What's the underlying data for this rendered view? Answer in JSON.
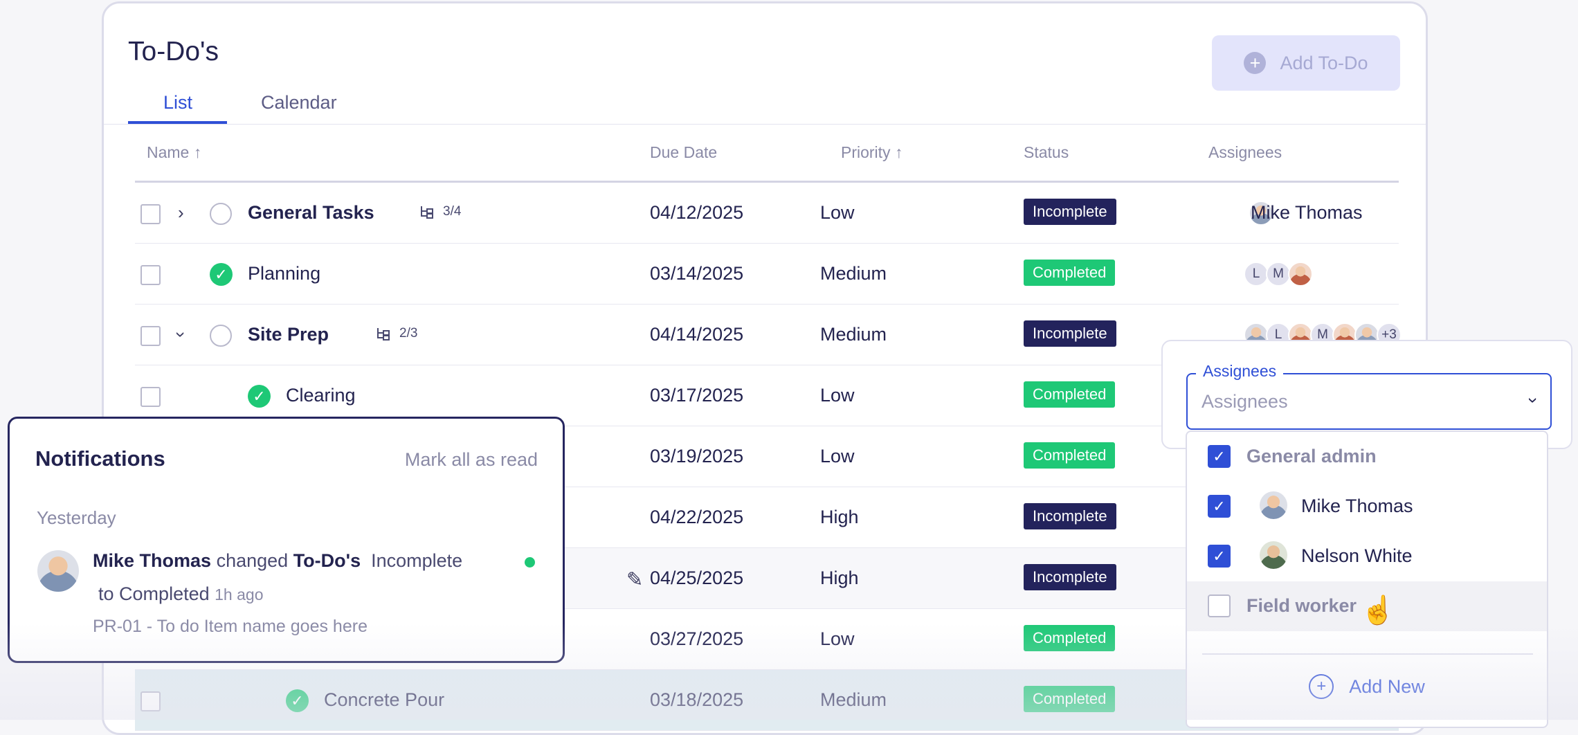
{
  "page": {
    "title": "To-Do's",
    "add_label": "Add To-Do"
  },
  "tabs": {
    "list": "List",
    "calendar": "Calendar"
  },
  "columns": {
    "name": "Name",
    "due": "Due Date",
    "priority": "Priority",
    "status": "Status",
    "assignees": "Assignees"
  },
  "rows": [
    {
      "name": "General Tasks",
      "count": "3/4",
      "due": "04/12/2025",
      "priority": "Low",
      "status": "Incomplete",
      "assignee": "Mike Thomas"
    },
    {
      "name": "Planning",
      "due": "03/14/2025",
      "priority": "Medium",
      "status": "Completed"
    },
    {
      "name": "Site Prep",
      "count": "2/3",
      "due": "04/14/2025",
      "priority": "Medium",
      "status": "Incomplete",
      "more": "+3"
    },
    {
      "name": "Clearing",
      "due": "03/17/2025",
      "priority": "Low",
      "status": "Completed"
    },
    {
      "due": "03/19/2025",
      "priority": "Low",
      "status": "Completed"
    },
    {
      "due": "04/22/2025",
      "priority": "High",
      "status": "Incomplete"
    },
    {
      "due": "04/25/2025",
      "priority": "High",
      "status": "Incomplete"
    },
    {
      "due": "03/27/2025",
      "priority": "Low",
      "status": "Completed"
    },
    {
      "name": "Concrete Pour",
      "due": "03/18/2025",
      "priority": "Medium",
      "status": "Completed"
    }
  ],
  "avatar_letters": {
    "l": "L",
    "m": "M"
  },
  "notifications": {
    "title": "Notifications",
    "mark_all": "Mark all as read",
    "group": "Yesterday",
    "item": {
      "actor": "Mike Thomas",
      "verb": "changed",
      "object": "To-Do's",
      "from": "Incomplete",
      "to_word": "to",
      "to": "Completed",
      "time": "1h ago",
      "detail": "PR-01 - To do Item name goes here"
    }
  },
  "assignee_dropdown": {
    "label": "Assignees",
    "placeholder": "Assignees",
    "options": [
      {
        "label": "General admin",
        "checked": true
      },
      {
        "label": "Mike Thomas",
        "checked": true
      },
      {
        "label": "Nelson White",
        "checked": true
      },
      {
        "label": "Field worker",
        "checked": false
      }
    ],
    "add_new": "Add New"
  },
  "colors": {
    "accent": "#2f4fd6",
    "completed": "#1ec876",
    "incomplete": "#23235c"
  }
}
